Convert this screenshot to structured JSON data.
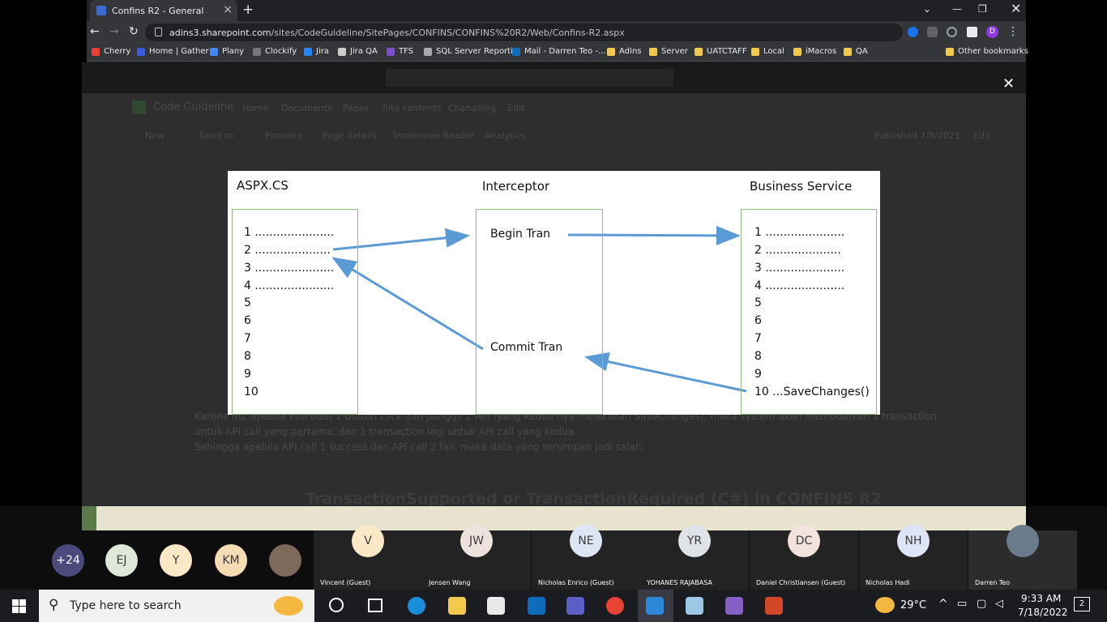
{
  "browser": {
    "tab_title": "Confins R2 - General",
    "url_host": "adins3.sharepoint.com",
    "url_path": "/sites/CodeGuideline/SitePages/CONFINS/CONFINS%20R2/Web/Confins-R2.aspx",
    "profile_initial": "D",
    "bookmarks": [
      "Cherry",
      "Home | Gather",
      "Plany",
      "Clockify",
      "Jira",
      "Jira QA",
      "TFS",
      "SQL Server Reporti...",
      "Mail - Darren Teo -...",
      "AdIns",
      "Server",
      "UATCTAFF",
      "Local",
      "iMacros",
      "QA"
    ],
    "other_bookmarks": "Other bookmarks"
  },
  "sharepoint": {
    "site_name": "Code Guideline",
    "nav": [
      "Home",
      "Documents",
      "Pages",
      "Site contents",
      "Changelog",
      "Edit"
    ],
    "toolbar": [
      "New",
      "Send to",
      "Promote",
      "Page details",
      "Immersive Reader",
      "Analytics"
    ],
    "published": "Published 7/8/2021",
    "edit_label": "Edit",
    "body_lines": [
      "Karena itu, apabila kita buat 1 button click dan panggil 2 API (yang kedua nya melakukan SaveChanges), maka system akan membuatkan 1 transaction",
      "untuk API call yang pertama, dan 1 transaction lagi untuk API call yang kedua.",
      "Sehingga apabila API call 1 success dan API call 2 fail, maka data yang tersimpan jadi salah."
    ],
    "heading": "TransactionSupported or TransactionRequired (C#) in CONFINS R2"
  },
  "diagram": {
    "col1_title": "ASPX.CS",
    "col2_title": "Interceptor",
    "col3_title": "Business Service",
    "left_lines": [
      "1 ......................",
      "2 .....................",
      "3 ......................",
      "4 ......................",
      "5",
      "6",
      "7",
      "8",
      "9",
      "10"
    ],
    "mid_begin": "Begin Tran",
    "mid_commit": "Commit Tran",
    "right_lines": [
      "1 ......................",
      "2 .....................",
      "3 ......................",
      "4 ......................",
      "5",
      "6",
      "7",
      "8",
      "9",
      "10 ...SaveChanges()"
    ],
    "arrow_color": "#5b9bd5"
  },
  "meeting": {
    "overflow": "+24",
    "small_avatars": [
      "EJ",
      "Y",
      "KM"
    ],
    "tiles": [
      {
        "initials": "V",
        "name": "Vincent (Guest)"
      },
      {
        "initials": "JW",
        "name": "Jensen Wang"
      },
      {
        "initials": "NE",
        "name": "Nicholas Enrico (Guest)"
      },
      {
        "initials": "YR",
        "name": "YOHANES RAJABASA"
      },
      {
        "initials": "DC",
        "name": "Daniel Christiansen (Guest)"
      },
      {
        "initials": "NH",
        "name": "Nicholas Hadi"
      },
      {
        "initials": "",
        "name": "Darren Teo"
      }
    ]
  },
  "taskbar": {
    "search_placeholder": "Type here to search",
    "temperature": "29°C",
    "time": "9:33 AM",
    "date": "7/18/2022",
    "notifications": "2"
  }
}
